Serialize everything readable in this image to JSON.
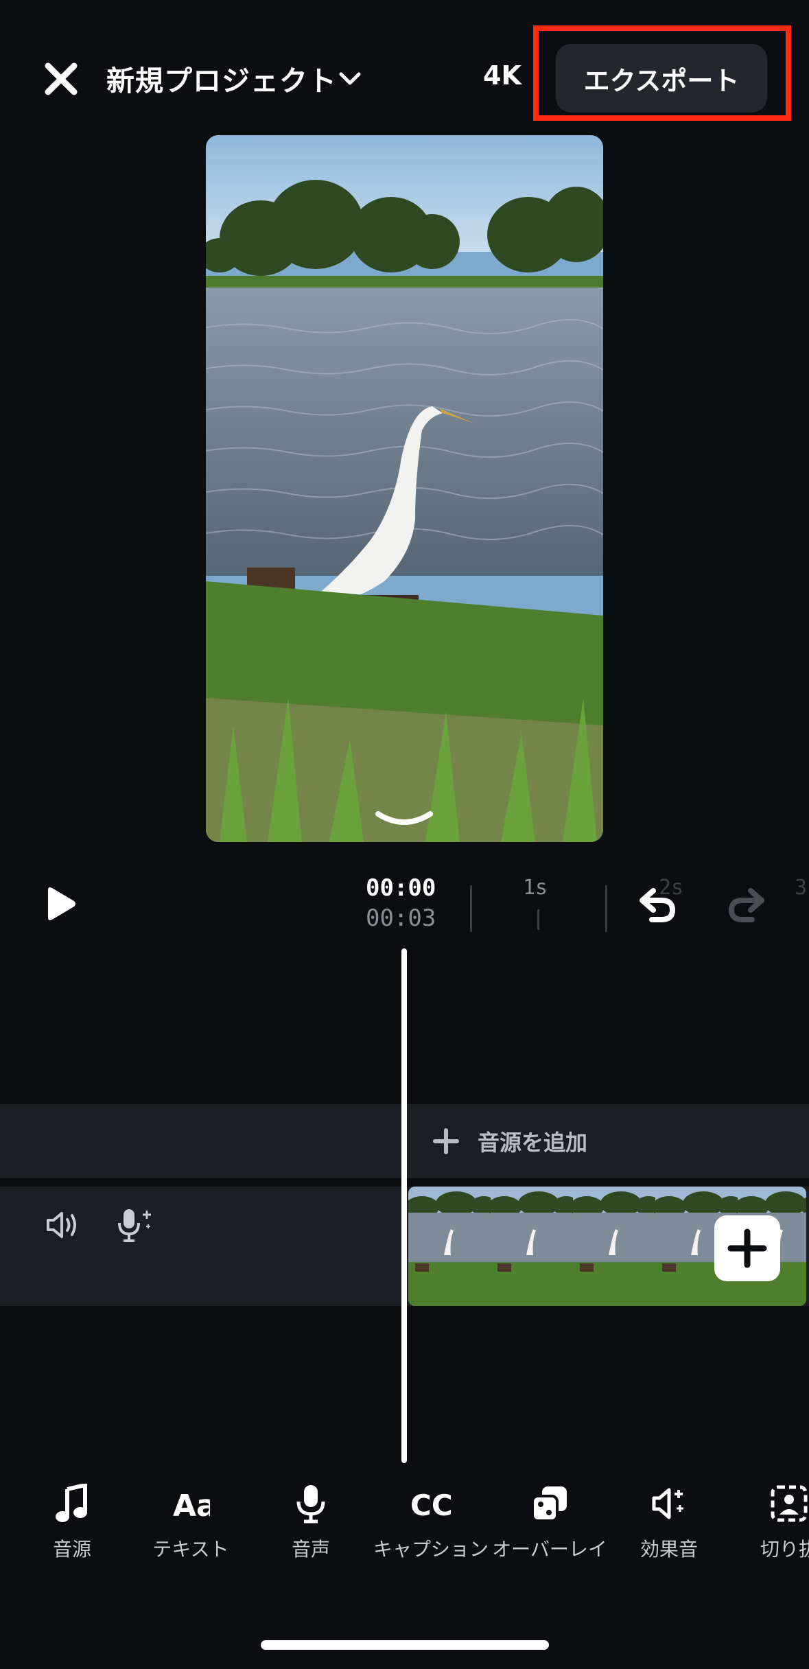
{
  "header": {
    "close_icon": "close-icon",
    "project_title": "新規プロジェクト",
    "dropdown_icon": "chevron-down-icon",
    "resolution": "4K",
    "export_label": "エクスポート",
    "highlight_color": "#ff2a12"
  },
  "timeline": {
    "current_time": "00:00",
    "total_time": "00:03",
    "ruler": [
      "1s",
      "2s",
      "3"
    ]
  },
  "tracks": {
    "add_audio_label": "音源を追加"
  },
  "toolbar": {
    "items": [
      {
        "label": "音源",
        "icon": "music-note-icon"
      },
      {
        "label": "テキスト",
        "icon": "text-aa-icon"
      },
      {
        "label": "音声",
        "icon": "microphone-icon"
      },
      {
        "label": "キャプション",
        "icon": "captions-cc-icon"
      },
      {
        "label": "オーバーレイ",
        "icon": "overlay-icon"
      },
      {
        "label": "効果音",
        "icon": "sound-effect-icon"
      },
      {
        "label": "切り抜",
        "icon": "cutout-icon"
      }
    ]
  }
}
